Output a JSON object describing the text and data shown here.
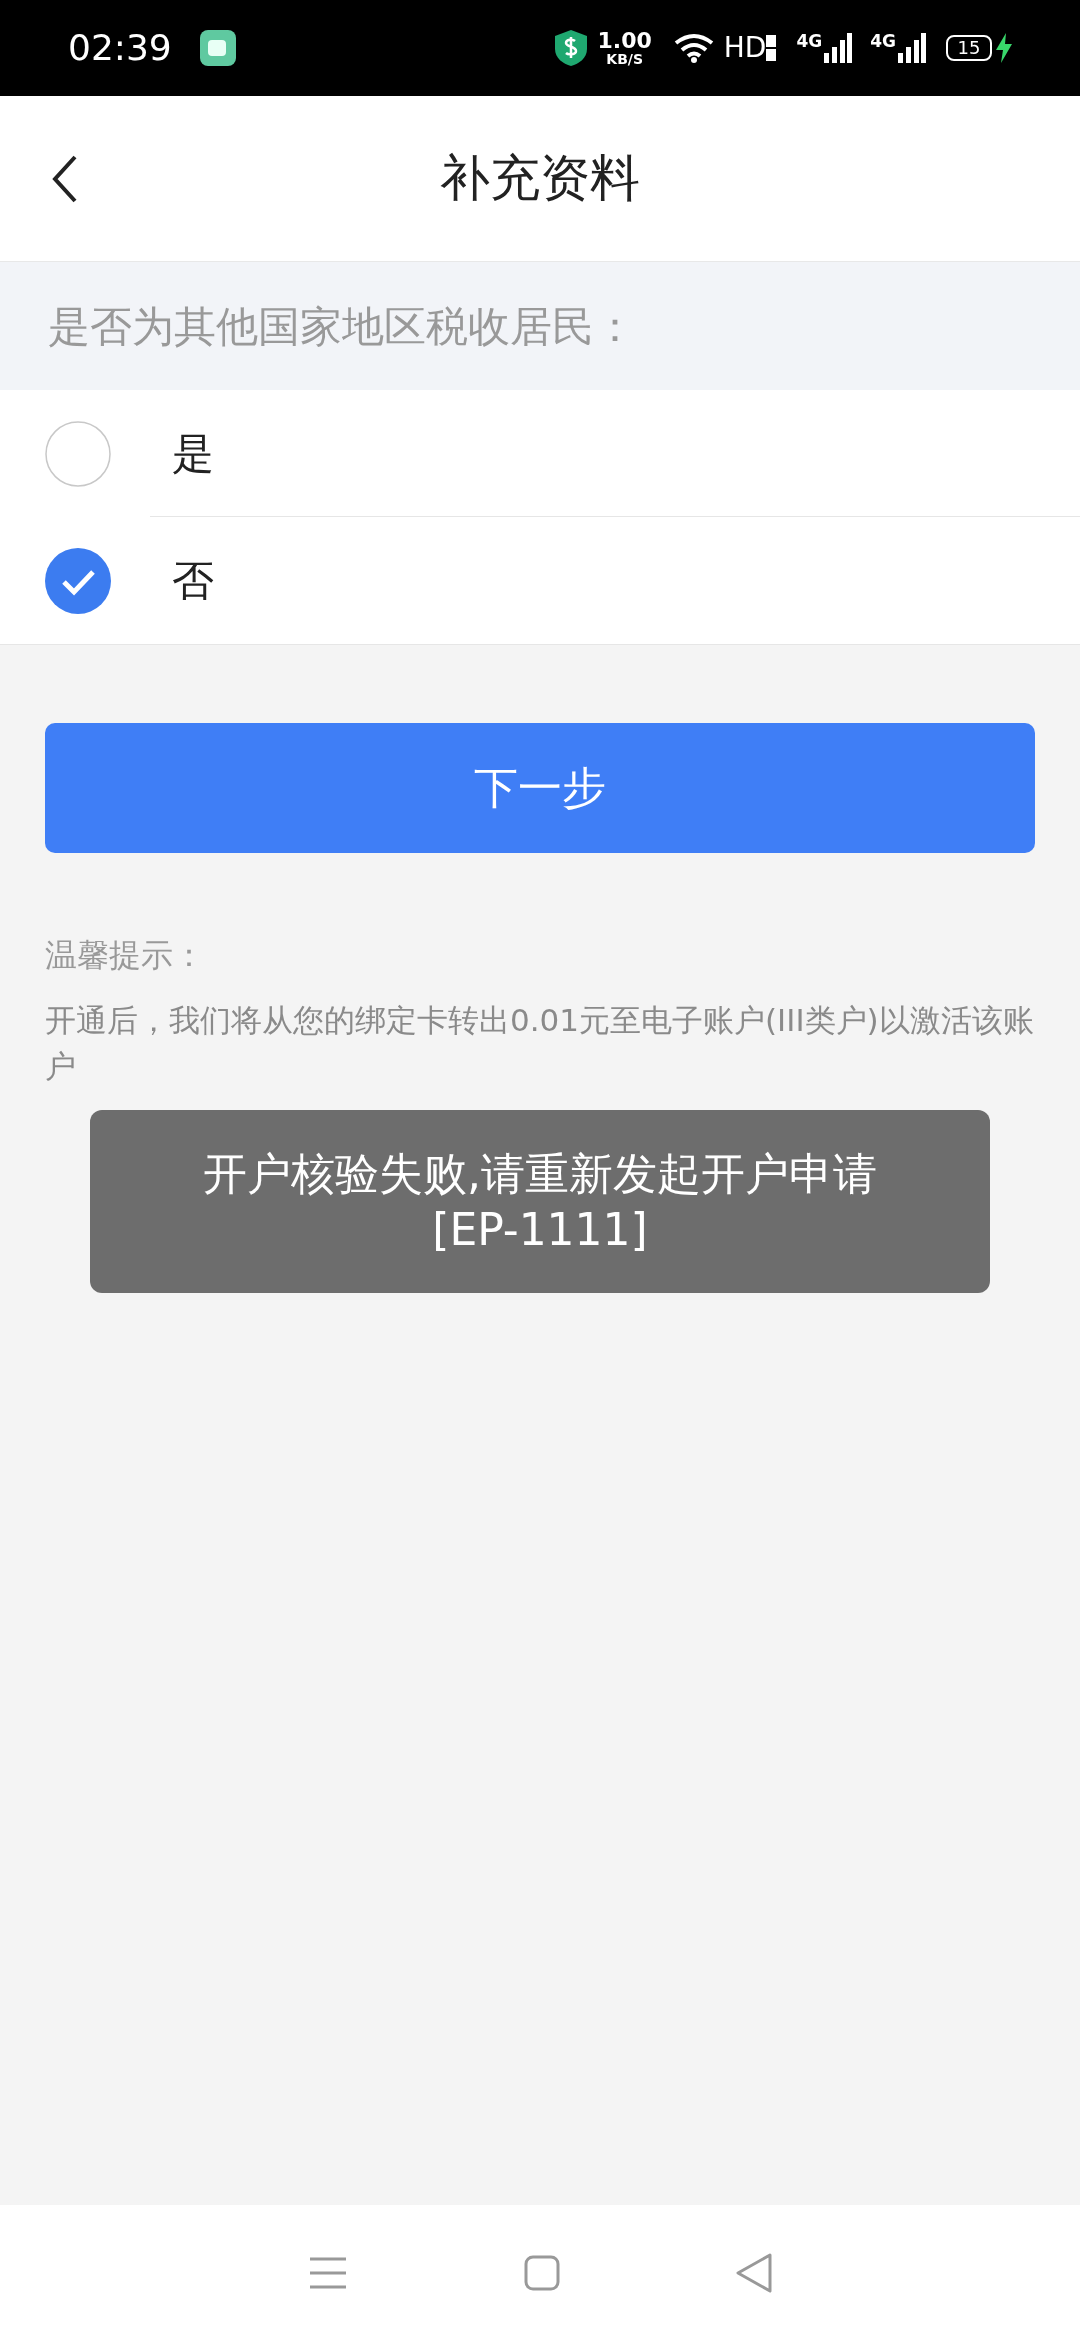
{
  "status_bar": {
    "time": "02:39",
    "speed_value": "1.00",
    "speed_unit": "KB/S",
    "hd": "HD",
    "signals": [
      "4G",
      "4G"
    ],
    "battery": "15",
    "charging": true
  },
  "header": {
    "title": "补充资料"
  },
  "question": {
    "label": "是否为其他国家地区税收居民："
  },
  "options": [
    {
      "label": "是",
      "selected": false
    },
    {
      "label": "否",
      "selected": true
    }
  ],
  "next_button": "下一步",
  "tips": {
    "title": "温馨提示：",
    "body": "开通后，我们将从您的绑定卡转出0.01元至电子账户(III类户)以激活该账户"
  },
  "toast": {
    "lines": [
      "开户核验失败,请重新发起开户申请",
      "[EP-1111]"
    ]
  }
}
